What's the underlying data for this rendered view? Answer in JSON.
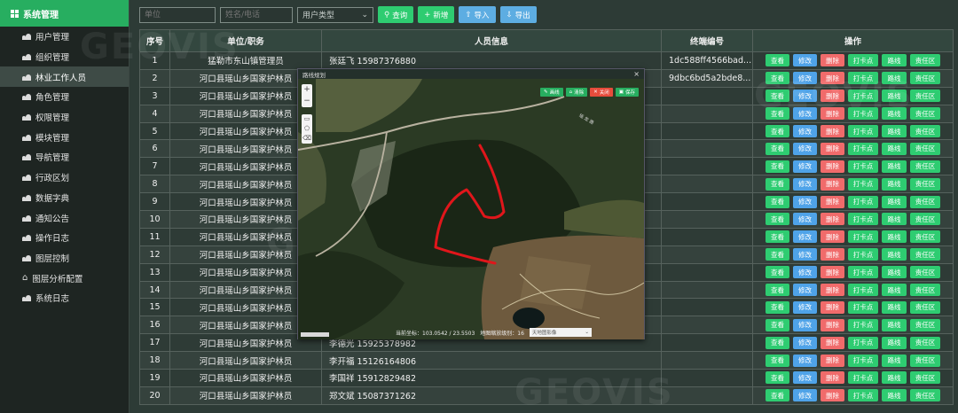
{
  "sidebar": {
    "title": "系统管理",
    "items": [
      {
        "label": "用户管理",
        "icon": "users-icon"
      },
      {
        "label": "组织管理",
        "icon": "users-icon"
      },
      {
        "label": "林业工作人员",
        "icon": "users-icon",
        "active": true
      },
      {
        "label": "角色管理",
        "icon": "users-icon"
      },
      {
        "label": "权限管理",
        "icon": "users-icon"
      },
      {
        "label": "模块管理",
        "icon": "users-icon"
      },
      {
        "label": "导航管理",
        "icon": "users-icon"
      },
      {
        "label": "行政区划",
        "icon": "users-icon"
      },
      {
        "label": "数据字典",
        "icon": "users-icon"
      },
      {
        "label": "通知公告",
        "icon": "users-icon"
      },
      {
        "label": "操作日志",
        "icon": "users-icon"
      },
      {
        "label": "图层控制",
        "icon": "users-icon"
      },
      {
        "label": "图层分析配置",
        "icon": "home-icon"
      },
      {
        "label": "系统日志",
        "icon": "users-icon"
      }
    ]
  },
  "toolbar": {
    "unit_placeholder": "单位",
    "name_placeholder": "姓名/电话",
    "user_type_placeholder": "用户类型",
    "query_label": "查询",
    "add_label": "新增",
    "import_label": "导入",
    "export_label": "导出"
  },
  "table": {
    "headers": {
      "index": "序号",
      "unit": "单位/职务",
      "person": "人员信息",
      "terminal": "终端编号",
      "ops": "操作"
    },
    "op_labels": {
      "view": "查看",
      "edit": "修改",
      "delete": "删除",
      "checkin": "打卡点",
      "route": "路线",
      "zone": "责任区"
    },
    "rows": [
      {
        "index": "1",
        "unit": "猛勒市东山镇管理员",
        "person": "张廷飞 15987376880",
        "terminal": "1dc588ff4566bad..."
      },
      {
        "index": "2",
        "unit": "河口县瑶山乡国家护林员",
        "person": "",
        "terminal": "9dbc6bd5a2bde8..."
      },
      {
        "index": "3",
        "unit": "河口县瑶山乡国家护林员",
        "person": "",
        "terminal": ""
      },
      {
        "index": "4",
        "unit": "河口县瑶山乡国家护林员",
        "person": "",
        "terminal": ""
      },
      {
        "index": "5",
        "unit": "河口县瑶山乡国家护林员",
        "person": "",
        "terminal": ""
      },
      {
        "index": "6",
        "unit": "河口县瑶山乡国家护林员",
        "person": "",
        "terminal": ""
      },
      {
        "index": "7",
        "unit": "河口县瑶山乡国家护林员",
        "person": "",
        "terminal": ""
      },
      {
        "index": "8",
        "unit": "河口县瑶山乡国家护林员",
        "person": "",
        "terminal": ""
      },
      {
        "index": "9",
        "unit": "河口县瑶山乡国家护林员",
        "person": "",
        "terminal": ""
      },
      {
        "index": "10",
        "unit": "河口县瑶山乡国家护林员",
        "person": "",
        "terminal": ""
      },
      {
        "index": "11",
        "unit": "河口县瑶山乡国家护林员",
        "person": "",
        "terminal": ""
      },
      {
        "index": "12",
        "unit": "河口县瑶山乡国家护林员",
        "person": "",
        "terminal": ""
      },
      {
        "index": "13",
        "unit": "河口县瑶山乡国家护林员",
        "person": "",
        "terminal": ""
      },
      {
        "index": "14",
        "unit": "河口县瑶山乡国家护林员",
        "person": "",
        "terminal": ""
      },
      {
        "index": "15",
        "unit": "河口县瑶山乡国家护林员",
        "person": "",
        "terminal": ""
      },
      {
        "index": "16",
        "unit": "河口县瑶山乡国家护林员",
        "person": "",
        "terminal": ""
      },
      {
        "index": "17",
        "unit": "河口县瑶山乡国家护林员",
        "person": "李德光 15925378982",
        "terminal": ""
      },
      {
        "index": "18",
        "unit": "河口县瑶山乡国家护林员",
        "person": "李开福 15126164806",
        "terminal": ""
      },
      {
        "index": "19",
        "unit": "河口县瑶山乡国家护林员",
        "person": "李国祥 15912829482",
        "terminal": ""
      },
      {
        "index": "20",
        "unit": "河口县瑶山乡国家护林员",
        "person": "郑文斌 15087371262",
        "terminal": ""
      }
    ]
  },
  "map_popup": {
    "title": "路线规划",
    "close": "×",
    "zoom_in": "+",
    "zoom_out": "−",
    "buttons": {
      "draw": "画线",
      "clear": "清除",
      "cancel": "关闭",
      "save": "保存"
    },
    "coords_label": "当前坐标：103.0542 / 23.5503",
    "zoom_label": "地图缩放级别：16",
    "layer_select": "天地图影像",
    "road_label": "瑶 龙 路"
  },
  "watermark": "GEOVIS",
  "colors": {
    "accent": "#27ae60",
    "route": "#e0161b",
    "edit": "#4fa3e8",
    "delete": "#f06b6b"
  }
}
